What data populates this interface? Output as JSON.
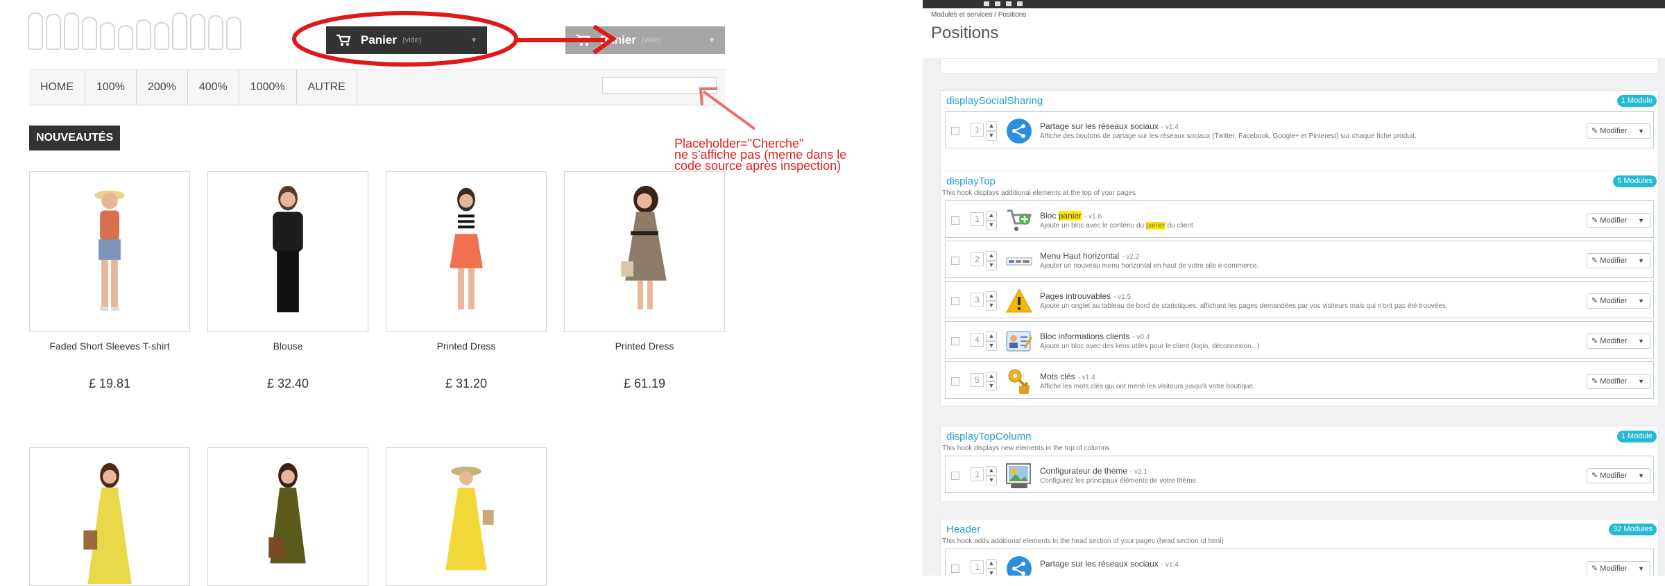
{
  "store": {
    "cart_label": "Panier",
    "cart_empty": "(vide)",
    "menu": [
      "HOME",
      "100%",
      "200%",
      "400%",
      "1000%",
      "AUTRE"
    ],
    "search_value": "",
    "new_badge": "NOUVEAUTÉS",
    "products": [
      {
        "name": "Faded Short Sleeves T-shirt",
        "price": "£ 19.81"
      },
      {
        "name": "Blouse",
        "price": "£ 32.40"
      },
      {
        "name": "Printed Dress",
        "price": "£ 31.20"
      },
      {
        "name": "Printed Dress",
        "price": "£ 61.19"
      }
    ],
    "annotation": {
      "line1": "Placeholder=\"Cherche\"",
      "line2": "ne s'affiche pas (meme dans le",
      "line3": "code source après inspection)",
      "color": "#e02020"
    }
  },
  "admin": {
    "breadcrumb": "Modules et services  /  Positions",
    "title": "Positions",
    "hooks": [
      {
        "name": "displaySocialSharing",
        "desc": "",
        "badge": "1 Module",
        "modules": [
          {
            "pos": "1",
            "name": "Partage sur les réseaux sociaux",
            "version": "- v1.4",
            "desc": "Affiche des boutons de partage sur les réseaux sociaux (Twitter, Facebook, Google+ et Pinterest) sur chaque fiche produit.",
            "icon": "share-icon"
          }
        ]
      },
      {
        "name": "displayTop",
        "desc": "This hook displays additional elements at the top of your pages",
        "badge": "5 Modules",
        "modules": [
          {
            "pos": "1",
            "name_pre": "Bloc ",
            "name_hl": "panier",
            "version": "- v1.6",
            "desc_pre": "Ajoute un bloc avec le contenu du ",
            "desc_hl": "panier",
            "desc_post": " du client",
            "icon": "cart-add-icon"
          },
          {
            "pos": "2",
            "name": "Menu Haut horizontal",
            "version": "- v2.2",
            "desc": "Ajouter un nouveau menu horizontal en haut de votre site e-commerce.",
            "icon": "menu-bar-icon"
          },
          {
            "pos": "3",
            "name": "Pages introuvables",
            "version": "- v1.5",
            "desc": "Ajoute un onglet au tableau de bord de statistiques, affichant les pages demandées par vos visiteurs mais qui n'ont pas été trouvées.",
            "icon": "warning-icon"
          },
          {
            "pos": "4",
            "name": "Bloc informations clients",
            "version": "- v0.4",
            "desc": "Ajoute un bloc avec des liens utiles pour le client (login, déconnexion...)",
            "icon": "user-card-icon"
          },
          {
            "pos": "5",
            "name": "Mots clés",
            "version": "- v1.4",
            "desc": "Affiche les mots clés qui ont mené les visiteurs jusqu'à votre boutique.",
            "icon": "keys-icon"
          }
        ]
      },
      {
        "name": "displayTopColumn",
        "desc": "This hook displays new elements in the top of columns",
        "badge": "1 Module",
        "modules": [
          {
            "pos": "1",
            "name": "Configurateur de thème",
            "version": "- v2.1",
            "desc": "Configurez les principaux éléments de votre thème.",
            "icon": "theme-config-icon"
          }
        ]
      },
      {
        "name": "Header",
        "desc": "This hook adds additional elements in the head section of your pages (head section of html)",
        "badge": "32 Modules",
        "modules": [
          {
            "pos": "1",
            "name": "Partage sur les réseaux sociaux",
            "version": "- v1.4",
            "desc": "",
            "icon": "share-icon"
          }
        ]
      }
    ],
    "modify_label": "Modifier"
  }
}
